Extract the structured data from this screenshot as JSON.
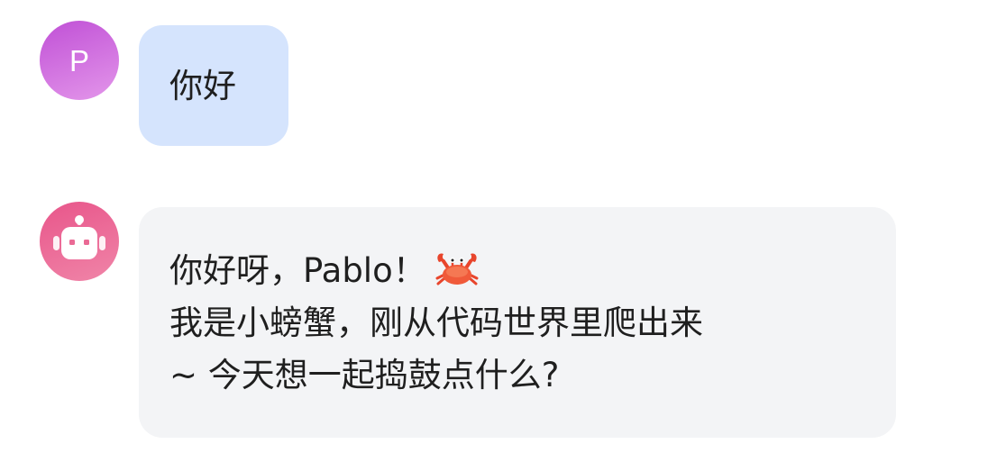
{
  "conversation": {
    "user_message": {
      "avatar_letter": "P",
      "text": "你好"
    },
    "bot_message": {
      "avatar_icon": "robot-icon",
      "lines": [
        "你好呀，Pablo！",
        "我是小螃蟹，刚从代码世界里爬出来",
        "~ 今天想一起捣鼓点什么?"
      ],
      "emoji_icon": "crab-icon"
    }
  },
  "colors": {
    "user_avatar": "#c050d6",
    "bot_avatar": "#e8558a",
    "user_bubble": "#d5e4fd",
    "bot_bubble": "#f3f4f6",
    "text": "#1f1f1f"
  }
}
